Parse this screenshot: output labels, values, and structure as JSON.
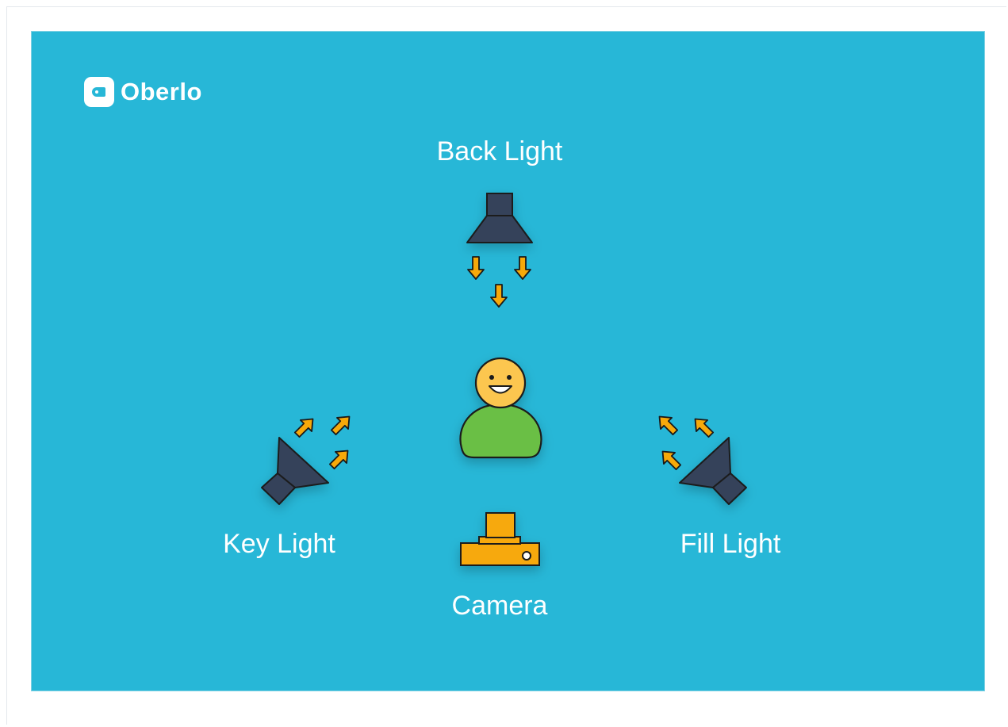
{
  "brand": {
    "name": "Oberlo",
    "logo_icon": "oberlo-tag-icon"
  },
  "labels": {
    "back_light": "Back Light",
    "key_light": "Key Light",
    "fill_light": "Fill Light",
    "camera": "Camera"
  },
  "colors": {
    "background": "#27b7d7",
    "light_fixture": "#34425a",
    "arrow": "#f7a90a",
    "camera": "#f7a90a",
    "subject_body": "#6bbf45",
    "subject_face": "#fcc650",
    "outline": "#1a1a1a"
  }
}
